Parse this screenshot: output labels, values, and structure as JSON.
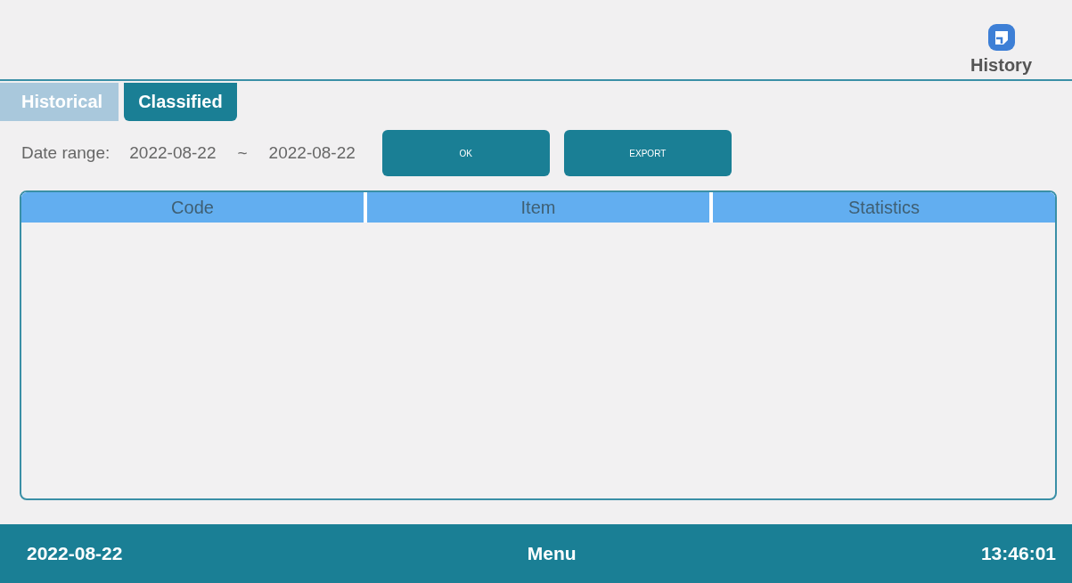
{
  "header": {
    "title": "History"
  },
  "tabs": [
    {
      "label": "Historical",
      "selected": false
    },
    {
      "label": "Classified",
      "selected": true
    }
  ],
  "filter": {
    "label": "Date range:",
    "start": "2022-08-22",
    "separator": "~",
    "end": "2022-08-22"
  },
  "buttons": [
    "OK",
    "EXPORT"
  ],
  "table": {
    "columns": [
      "Code",
      "Item",
      "Statistics"
    ]
  },
  "status_bar": {
    "date": "2022-08-22",
    "menu": "Menu",
    "time": "13:46:01"
  }
}
